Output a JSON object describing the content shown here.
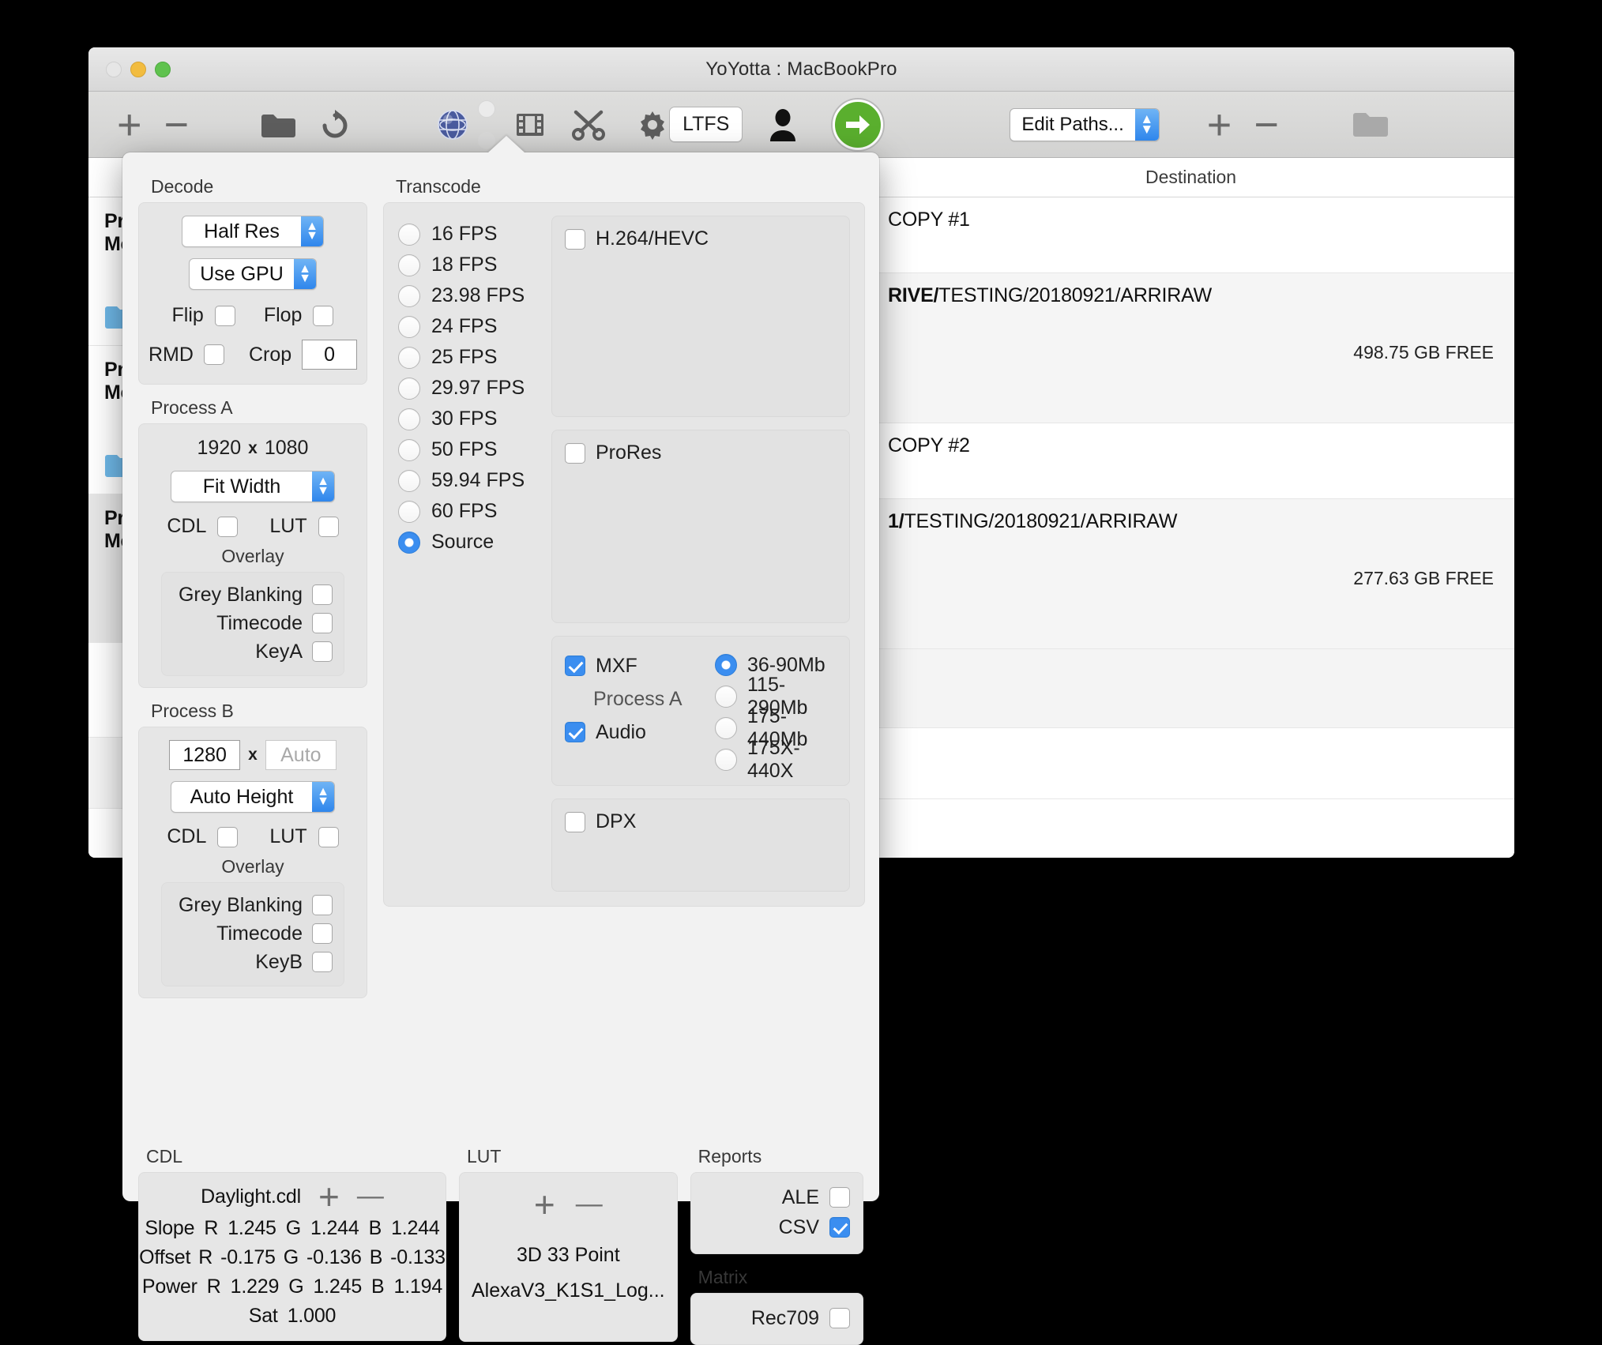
{
  "window": {
    "title": "YoYotta : MacBookPro"
  },
  "toolbar": {
    "add_label": "+",
    "remove_label": "−",
    "ltfs_label": "LTFS",
    "paths_select": {
      "value": "Edit Paths...",
      "options": [
        "Edit Paths..."
      ]
    },
    "icons": [
      "plus-icon",
      "minus-icon",
      "folder-icon",
      "refresh-icon",
      "globe-icon",
      "filmstrip-icon",
      "scissors-icon",
      "gear-icon",
      "person-icon",
      "go-arrow-icon",
      "plus-icon",
      "minus-icon",
      "folder-icon"
    ]
  },
  "list": {
    "destination_header": "Destination",
    "left_rows": [
      {
        "line1": "Pro",
        "line2": "Me"
      },
      {
        "line1": "Pro",
        "line2": "Me"
      },
      {
        "line1": "Pro",
        "line2": "Me"
      }
    ],
    "right_rows": [
      {
        "copy": "COPY #1"
      },
      {
        "path_bold": "RIVE/",
        "path_rest": "TESTING/20180921/ARRIRAW",
        "free": "498.75 GB FREE"
      },
      {
        "copy": "COPY #2"
      },
      {
        "path_bold": "1/",
        "path_rest": "TESTING/20180921/ARRIRAW",
        "free": "277.63 GB FREE"
      }
    ]
  },
  "popover": {
    "decode": {
      "title": "Decode",
      "res_select": {
        "value": "Half Res"
      },
      "gpu_select": {
        "value": "Use GPU"
      },
      "flip_label": "Flip",
      "flip_checked": false,
      "flop_label": "Flop",
      "flop_checked": false,
      "rmd_label": "RMD",
      "rmd_checked": false,
      "crop_label": "Crop",
      "crop_value": "0"
    },
    "process_a": {
      "title": "Process A",
      "width": "1920",
      "x": "x",
      "height": "1080",
      "fit_select": {
        "value": "Fit Width"
      },
      "cdl_label": "CDL",
      "cdl_checked": false,
      "lut_label": "LUT",
      "lut_checked": false,
      "overlay_title": "Overlay",
      "overlay": [
        {
          "label": "Grey Blanking",
          "checked": false
        },
        {
          "label": "Timecode",
          "checked": false
        },
        {
          "label": "KeyA",
          "checked": false
        }
      ]
    },
    "process_b": {
      "title": "Process B",
      "width": "1280",
      "x": "x",
      "height_placeholder": "Auto",
      "fit_select": {
        "value": "Auto Height"
      },
      "cdl_label": "CDL",
      "cdl_checked": false,
      "lut_label": "LUT",
      "lut_checked": false,
      "overlay_title": "Overlay",
      "overlay": [
        {
          "label": "Grey Blanking",
          "checked": false
        },
        {
          "label": "Timecode",
          "checked": false
        },
        {
          "label": "KeyB",
          "checked": false
        }
      ]
    },
    "transcode": {
      "title": "Transcode",
      "fps": [
        {
          "label": "16 FPS",
          "selected": false
        },
        {
          "label": "18 FPS",
          "selected": false
        },
        {
          "label": "23.98 FPS",
          "selected": false
        },
        {
          "label": "24 FPS",
          "selected": false
        },
        {
          "label": "25 FPS",
          "selected": false
        },
        {
          "label": "29.97 FPS",
          "selected": false
        },
        {
          "label": "30 FPS",
          "selected": false
        },
        {
          "label": "50 FPS",
          "selected": false
        },
        {
          "label": "59.94 FPS",
          "selected": false
        },
        {
          "label": "60 FPS",
          "selected": false
        },
        {
          "label": "Source",
          "selected": true
        }
      ],
      "h264": {
        "label": "H.264/HEVC",
        "checked": false
      },
      "prores": {
        "label": "ProRes",
        "checked": false
      },
      "mxf": {
        "label": "MXF",
        "checked": true,
        "process_label": "Process A",
        "audio_label": "Audio",
        "audio_checked": true,
        "bitrates": [
          {
            "label": "36-90Mb",
            "selected": true
          },
          {
            "label": "115-290Mb",
            "selected": false
          },
          {
            "label": "175-440Mb",
            "selected": false
          },
          {
            "label": "175X-440X",
            "selected": false
          }
        ]
      },
      "dpx": {
        "label": "DPX",
        "checked": false
      }
    },
    "cdl": {
      "title": "CDL",
      "file": "Daylight.cdl",
      "add": "+",
      "remove": "—",
      "rows": [
        {
          "name": "Slope",
          "r_label": "R",
          "r": "1.245",
          "g_label": "G",
          "g": "1.244",
          "b_label": "B",
          "b": "1.244"
        },
        {
          "name": "Offset",
          "r_label": "R",
          "r": "-0.175",
          "g_label": "G",
          "g": "-0.136",
          "b_label": "B",
          "b": "-0.133"
        },
        {
          "name": "Power",
          "r_label": "R",
          "r": "1.229",
          "g_label": "G",
          "g": "1.245",
          "b_label": "B",
          "b": "1.194"
        }
      ],
      "sat_label": "Sat",
      "sat": "1.000"
    },
    "lut": {
      "title": "LUT",
      "add": "+",
      "remove": "—",
      "type": "3D 33 Point",
      "file": "AlexaV3_K1S1_Log..."
    },
    "reports": {
      "title": "Reports",
      "items": [
        {
          "label": "ALE",
          "checked": false
        },
        {
          "label": "CSV",
          "checked": true
        }
      ]
    },
    "matrix": {
      "title": "Matrix",
      "items": [
        {
          "label": "Rec709",
          "checked": false
        }
      ]
    }
  },
  "colors": {
    "accent": "#3b8ef0",
    "go_green": "#5aaf2e",
    "folder_blue": "#6fb8e8"
  }
}
